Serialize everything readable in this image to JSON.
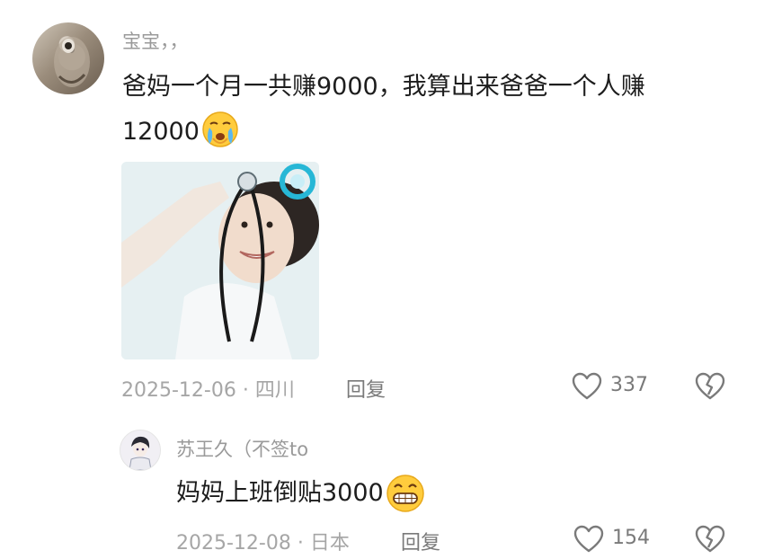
{
  "comment": {
    "author": "宝宝，，",
    "text_line1": "爸妈一个月一共赚9000，我算出来爸爸一个人赚",
    "text_line2": "12000",
    "emoji": "crying-face",
    "date_location": "2025-12-06 · 四川",
    "reply_label": "回复",
    "like_count": "337"
  },
  "reply": {
    "author": "苏王久（不签to",
    "text": "妈妈上班倒贴3000",
    "emoji": "grinning-face",
    "date_location": "2025-12-08 · 日本",
    "reply_label": "回复",
    "like_count": "154"
  }
}
